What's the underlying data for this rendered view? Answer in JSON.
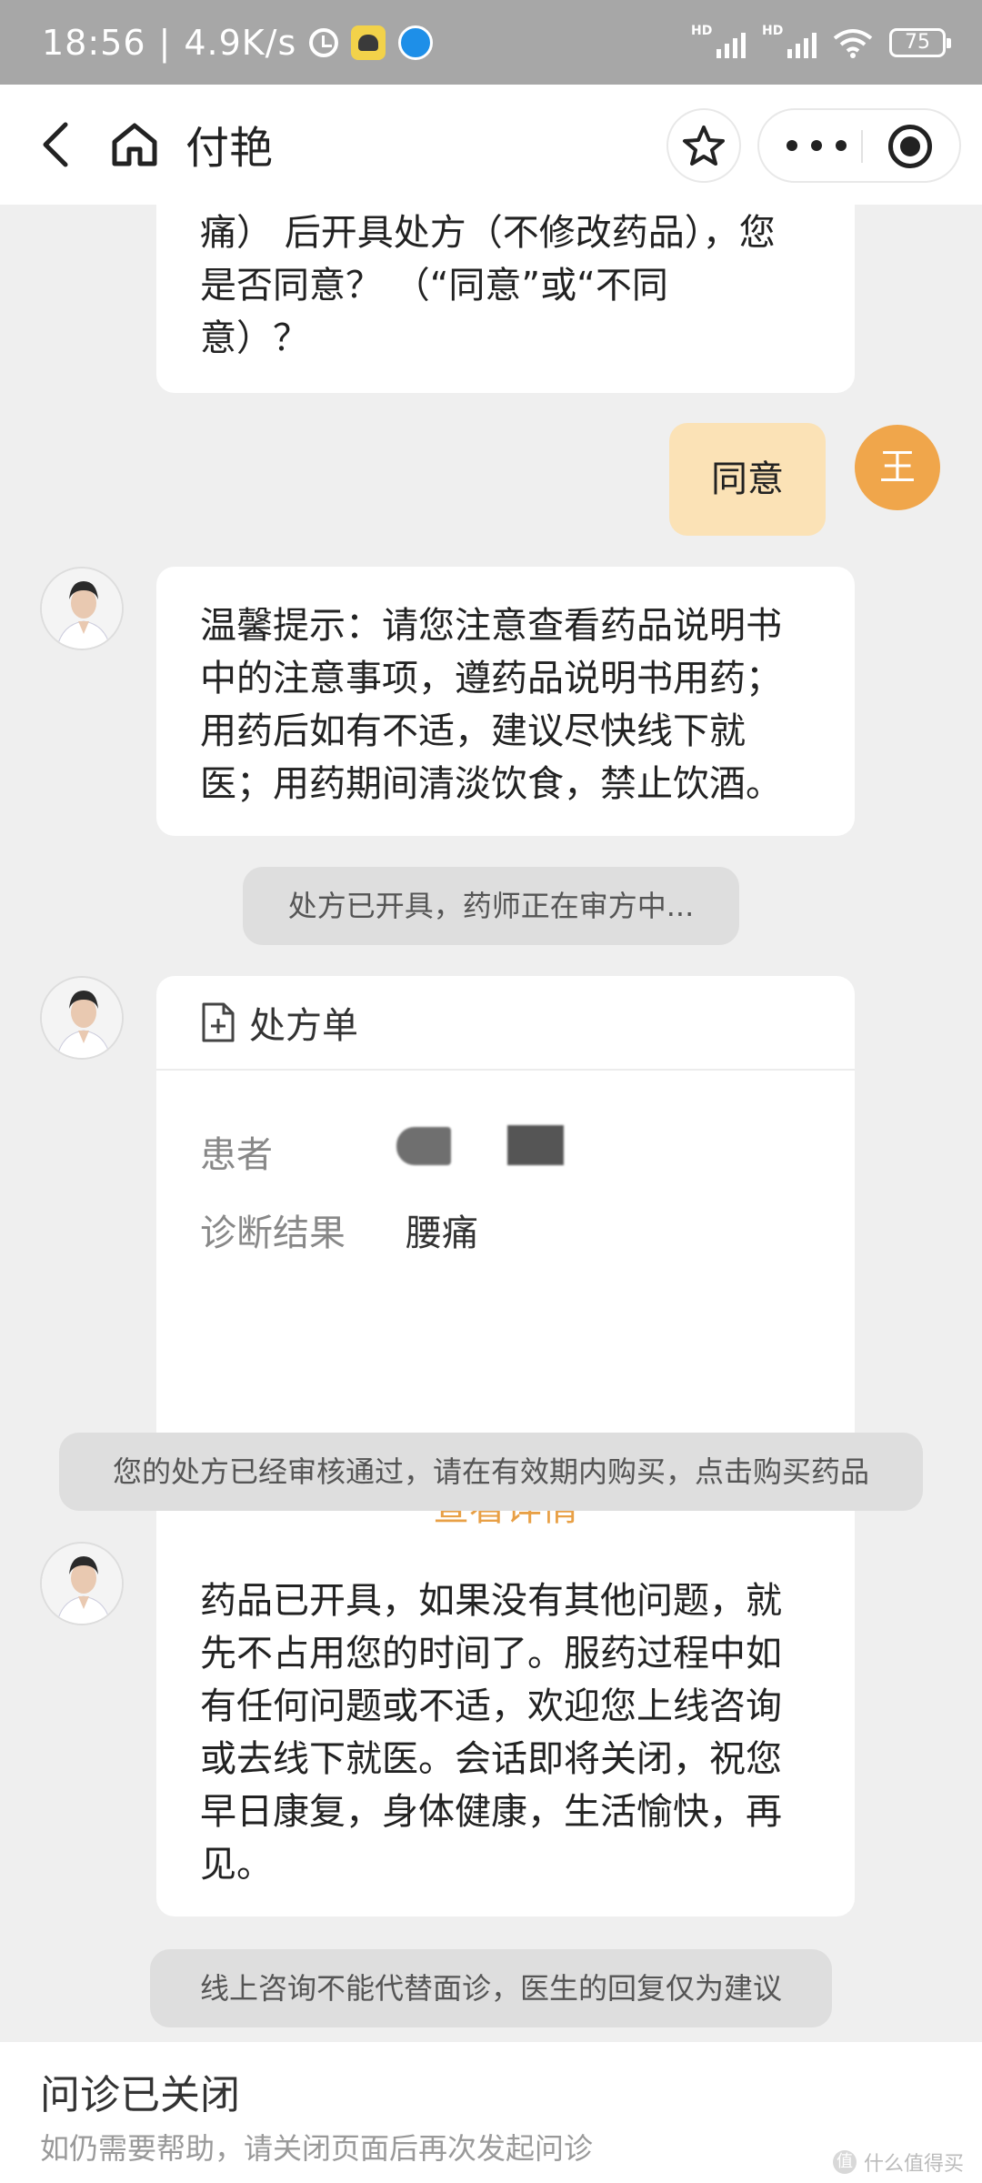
{
  "status_bar": {
    "time": "18:56",
    "speed": "4.9K/s",
    "battery": "75",
    "hd_label": "HD"
  },
  "nav": {
    "title": "付艳"
  },
  "messages": {
    "doctor_partial": [
      "痛） 后开具处方（不修改药品），您",
      "是否同意？ （“同意”或“不同",
      "意）？"
    ],
    "user_reply": "同意",
    "user_avatar_char": "王",
    "doctor_tip": [
      "温馨提示：请您注意查看药品说明书",
      "中的注意事项，遵药品说明书用药；",
      "用药后如有不适，建议尽快线下就",
      "医；用药期间清淡饮食，禁止饮酒。"
    ],
    "sys_issued": "处方已开具，药师正在审方中...",
    "sys_approved": "您的处方已经审核通过，请在有效期内购买，点击购买药品",
    "doctor_closing": [
      "药品已开具，如果没有其他问题，就",
      "先不占用您的时间了。服药过程中如",
      "有任何问题或不适，欢迎您上线咨询",
      "或去线下就医。会话即将关闭，祝您",
      "早日康复，身体健康，生活愉快，再",
      "见。"
    ],
    "sys_disclaimer": "线上咨询不能代替面诊，医生的回复仅为建议"
  },
  "prescription": {
    "title": "处方单",
    "patient_label": "患者",
    "diagnosis_label": "诊断结果",
    "diagnosis_value": "腰痛",
    "detail_link": "查看详情"
  },
  "bottom": {
    "title": "问诊已关闭",
    "subtitle": "如仍需要帮助，请关闭页面后再次发起问诊",
    "watermark": "什么值得买"
  },
  "colors": {
    "status_bar": "#a7a7a7",
    "user_bubble": "#fbe2b6",
    "user_avatar": "#f0a64b",
    "link": "#e8a046",
    "chat_bg": "#efefef"
  },
  "icons": [
    "back-arrow-icon",
    "home-icon",
    "star-icon",
    "more-dots-icon",
    "target-icon",
    "prescription-doc-icon",
    "alarm-icon",
    "wifi-icon",
    "battery-icon"
  ]
}
